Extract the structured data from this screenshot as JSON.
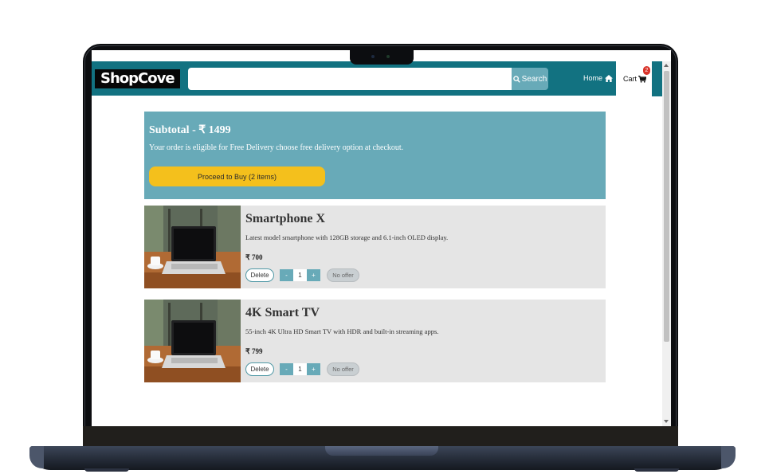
{
  "colors": {
    "navbar": "#127281",
    "accent": "#68aab8",
    "proceed": "#f4c01c",
    "item_bg": "#e5e5e5",
    "badge": "#d9342b"
  },
  "navbar": {
    "brand": "ShopCove",
    "search_placeholder": "",
    "search_button": "Search",
    "home_label": "Home",
    "cart_label": "Cart",
    "cart_count": "2"
  },
  "subtotal": {
    "label": "Subtotal - ",
    "amount": "₹ 1499",
    "note": "Your order is eligible for Free Delivery choose free delivery option at checkout.",
    "proceed_button": "Proceed to Buy (2 items)"
  },
  "items": [
    {
      "title": "Smartphone X",
      "description": "Latest model smartphone with 128GB storage and 6.1-inch OLED display.",
      "price": "₹ 700",
      "delete": "Delete",
      "qty_minus": "-",
      "quantity": "1",
      "qty_plus": "+",
      "offer": "No offer",
      "image_icon": "laptop-on-desk-photo"
    },
    {
      "title": "4K Smart TV",
      "description": "55-inch 4K Ultra HD Smart TV with HDR and built-in streaming apps.",
      "price": "₹ 799",
      "delete": "Delete",
      "qty_minus": "-",
      "quantity": "1",
      "qty_plus": "+",
      "offer": "No offer",
      "image_icon": "laptop-on-desk-photo"
    }
  ]
}
